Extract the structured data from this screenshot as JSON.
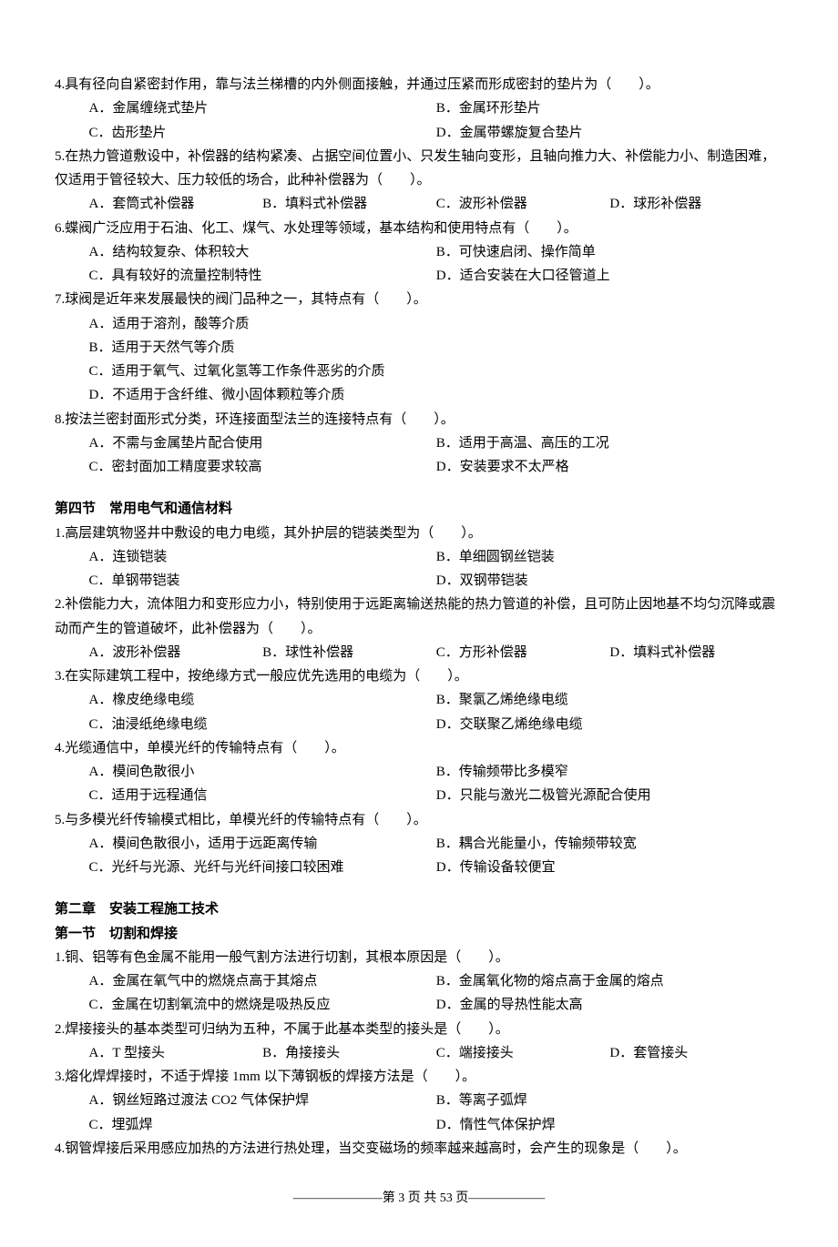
{
  "s3": {
    "q4": {
      "text": "4.具有径向自紧密封作用，靠与法兰梯槽的内外侧面接触，并通过压紧而形成密封的垫片为（　　）。",
      "a": "A．金属缠绕式垫片",
      "b": "B．金属环形垫片",
      "c": "C．齿形垫片",
      "d": "D．金属带螺旋复合垫片"
    },
    "q5": {
      "text": "5.在热力管道敷设中，补偿器的结构紧凑、占据空间位置小、只发生轴向变形，且轴向推力大、补偿能力小、制造困难，仅适用于管径较大、压力较低的场合，此种补偿器为（　　）。",
      "a": "A．套筒式补偿器",
      "b": "B．填料式补偿器",
      "c": "C．波形补偿器",
      "d": "D．球形补偿器"
    },
    "q6": {
      "text": "6.蝶阀广泛应用于石油、化工、煤气、水处理等领域，基本结构和使用特点有（　　）。",
      "a": "A．结构较复杂、体积较大",
      "b": "B．可快速启闭、操作简单",
      "c": "C．具有较好的流量控制特性",
      "d": "D．适合安装在大口径管道上"
    },
    "q7": {
      "text": "7.球阀是近年来发展最快的阀门品种之一，其特点有（　　）。",
      "a": "A．适用于溶剂，酸等介质",
      "b": "B．适用于天然气等介质",
      "c": "C．适用于氧气、过氧化氢等工作条件恶劣的介质",
      "d": "D．不适用于含纤维、微小固体颗粒等介质"
    },
    "q8": {
      "text": "8.按法兰密封面形式分类，环连接面型法兰的连接特点有（　　）。",
      "a": "A．不需与金属垫片配合使用",
      "b": "B．适用于高温、高压的工况",
      "c": "C．密封面加工精度要求较高",
      "d": "D．安装要求不太严格"
    }
  },
  "s4_title": "第四节　常用电气和通信材料",
  "s4": {
    "q1": {
      "text": "1.高层建筑物竖井中敷设的电力电缆，其外护层的铠装类型为（　　）。",
      "a": "A．连锁铠装",
      "b": "B．单细圆钢丝铠装",
      "c": "C．单钢带铠装",
      "d": "D．双钢带铠装"
    },
    "q2": {
      "text": "2.补偿能力大，流体阻力和变形应力小，特别使用于远距离输送热能的热力管道的补偿，且可防止因地基不均匀沉降或震动而产生的管道破坏，此补偿器为（　　）。",
      "a": "A．波形补偿器",
      "b": "B．球性补偿器",
      "c": "C．方形补偿器",
      "d": "D．填料式补偿器"
    },
    "q3": {
      "text": "3.在实际建筑工程中，按绝缘方式一般应优先选用的电缆为（　　）。",
      "a": "A．橡皮绝缘电缆",
      "b": "B．聚氯乙烯绝缘电缆",
      "c": "C．油浸纸绝缘电缆",
      "d": "D．交联聚乙烯绝缘电缆"
    },
    "q4": {
      "text": "4.光缆通信中，单模光纤的传输特点有（　　）。",
      "a": "A．模间色散很小",
      "b": "B．传输频带比多模窄",
      "c": "C．适用于远程通信",
      "d": "D．只能与激光二极管光源配合使用"
    },
    "q5": {
      "text": "5.与多模光纤传输模式相比，单模光纤的传输特点有（　　）。",
      "a": "A．模间色散很小，适用于远距离传输",
      "b": "B．耦合光能量小，传输频带较宽",
      "c": "C．光纤与光源、光纤与光纤间接口较困难",
      "d": "D．传输设备较便宜"
    }
  },
  "ch2_title": "第二章　安装工程施工技术",
  "ch2_s1_title": "第一节　切割和焊接",
  "ch2s1": {
    "q1": {
      "text": "1.铜、铝等有色金属不能用一般气割方法进行切割，其根本原因是（　　）。",
      "a": "A．金属在氧气中的燃烧点高于其熔点",
      "b": "B．金属氧化物的熔点高于金属的熔点",
      "c": "C．金属在切割氧流中的燃烧是吸热反应",
      "d": "D．金属的导热性能太高"
    },
    "q2": {
      "text": "2.焊接接头的基本类型可归纳为五种，不属于此基本类型的接头是（　　）。",
      "a": "A．T 型接头",
      "b": "B．角接接头",
      "c": "C．端接接头",
      "d": "D．套管接头"
    },
    "q3": {
      "text": "3.熔化焊焊接时，不适于焊接 1mm 以下薄钢板的焊接方法是（　　）。",
      "a": "A．钢丝短路过渡法 CO2 气体保护焊",
      "b": "B．等离子弧焊",
      "c": "C．埋弧焊",
      "d": "D．惰性气体保护焊"
    },
    "q4": {
      "text": "4.钢管焊接后采用感应加热的方法进行热处理，当交变磁场的频率越来越高时，会产生的现象是（　　）。"
    }
  },
  "footer": "———————第 3 页  共 53 页——————"
}
